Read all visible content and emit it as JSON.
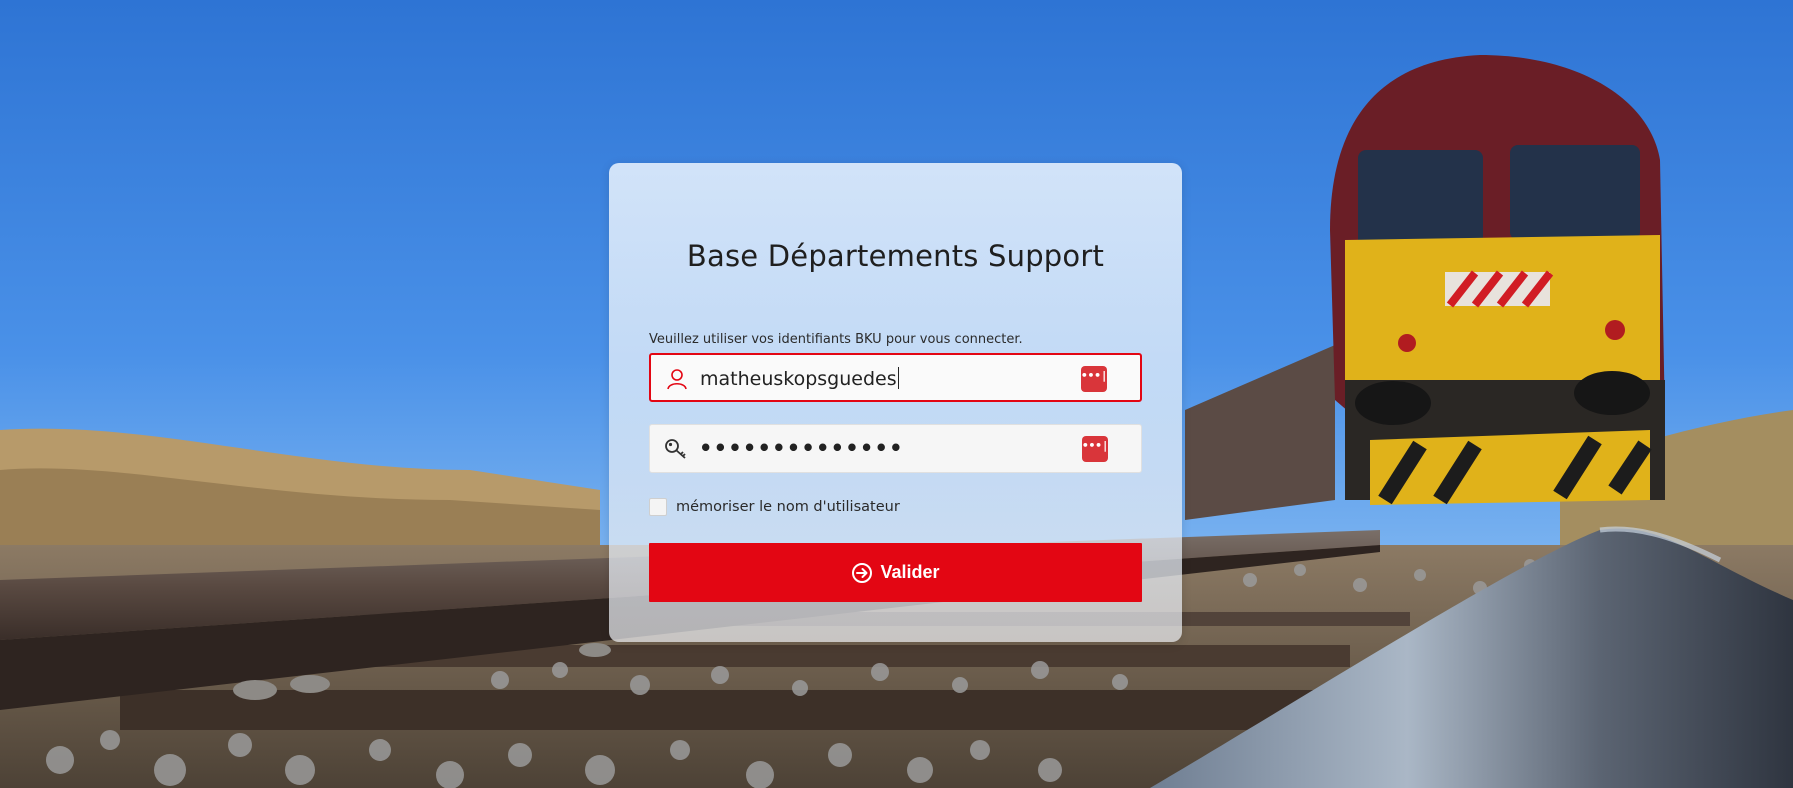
{
  "page": {
    "title": "Base Départements Support",
    "hint": "Veuillez utiliser vos identifiants BKU pour vous connecter."
  },
  "login": {
    "username": {
      "value": "matheuskopsguedes",
      "icon": "user-icon",
      "password_manager_icon": "password-manager-icon"
    },
    "password": {
      "masked_value": "••••••••••••••",
      "icon": "key-icon",
      "password_manager_icon": "password-manager-icon"
    },
    "remember_label": "mémoriser le nom d'utilisateur",
    "remember_checked": false,
    "submit_label": "Valider",
    "submit_icon": "arrow-circle-right-icon"
  },
  "background": {
    "description_icon": "train-on-tracks-photo"
  },
  "colors": {
    "accent": "#e30613",
    "password_manager": "#d9353a",
    "title_text": "#1f1f1f"
  }
}
